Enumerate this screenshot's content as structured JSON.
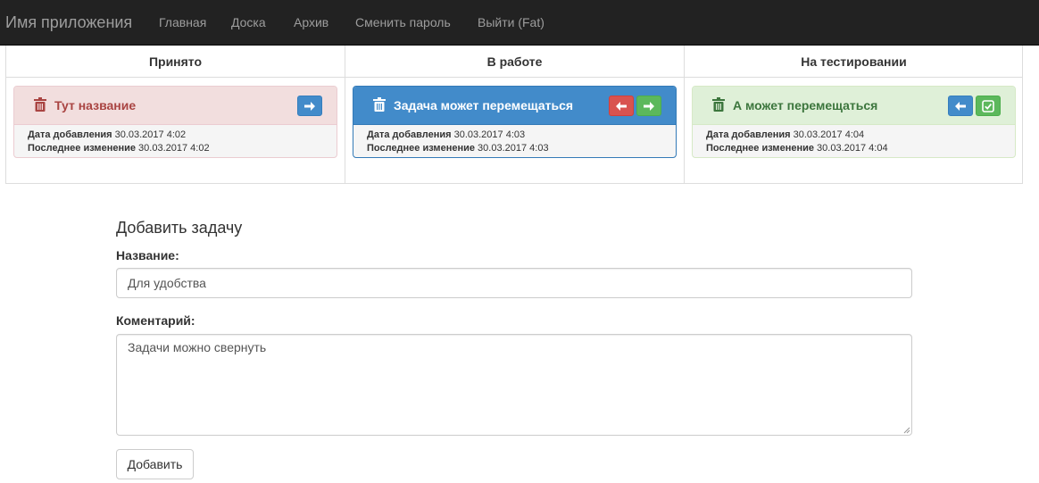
{
  "navbar": {
    "brand": "Имя приложения",
    "links": [
      "Главная",
      "Доска",
      "Архив",
      "Сменить пароль",
      "Выйти (Fat)"
    ]
  },
  "board": {
    "columns": [
      {
        "title": "Принято",
        "card": {
          "title": "Тут название",
          "added_label": "Дата добавления",
          "added": "30.03.2017 4:02",
          "changed_label": "Последнее изменение",
          "changed": "30.03.2017 4:02"
        }
      },
      {
        "title": "В работе",
        "card": {
          "title": "Задача может перемещаться",
          "added_label": "Дата добавления",
          "added": "30.03.2017 4:03",
          "changed_label": "Последнее изменение",
          "changed": "30.03.2017 4:03"
        }
      },
      {
        "title": "На тестировании",
        "card": {
          "title": "А может перемещаться",
          "added_label": "Дата добавления",
          "added": "30.03.2017 4:04",
          "changed_label": "Последнее изменение",
          "changed": "30.03.2017 4:04"
        }
      }
    ]
  },
  "form": {
    "title": "Добавить задачу",
    "name_label": "Название:",
    "name_value": "Для удобства",
    "comment_label": "Коментарий:",
    "comment_value": "Задачи можно свернуть",
    "submit_label": "Добавить"
  },
  "colors": {
    "navbar": "#222222",
    "danger": "#f2dede",
    "primary": "#428bca",
    "success": "#dff0d8"
  },
  "icons": [
    "trash-icon",
    "arrow-right-icon",
    "arrow-left-icon",
    "check-icon"
  ]
}
